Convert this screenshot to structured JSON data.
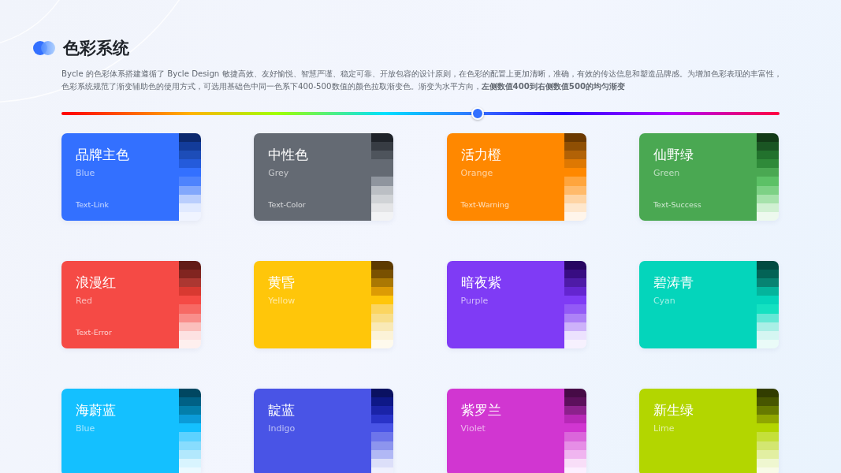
{
  "title": "色彩系统",
  "description": "Bycle 的色彩体系搭建遵循了 Bycle Design 敏捷高效、友好愉悦、智慧严谨、稳定可靠、开放包容的设计原则，在色彩的配置上更加清晰，准确，有效的传达信息和塑造品牌感。为增加色彩表现的丰富性，色彩系统规范了渐变辅助色的使用方式，可选用基础色中同一色系下400-500数值的颜色拉取渐变色。渐变为水平方向，**左侧数值400到右侧数值500的均匀渐变**",
  "gradient_slider": {
    "level": 0.58
  },
  "cards": [
    {
      "name": "品牌主色",
      "english": "Blue",
      "role": "Text-Link",
      "color": "#3370ff",
      "swatches": [
        {
          "color": "#0c296e"
        },
        {
          "color": "#133c9a"
        },
        {
          "color": "#1d4db8"
        },
        {
          "color": "#245bdb"
        },
        {
          "color": "#3370ff"
        },
        {
          "color": "#4e83fd"
        },
        {
          "color": "#82a7fc"
        },
        {
          "color": "#bacefd"
        },
        {
          "color": "#e1eaff"
        },
        {
          "color": "#f0f4ff"
        }
      ]
    },
    {
      "name": "中性色",
      "english": "Grey",
      "role": "Text-Color",
      "color": "#646a73",
      "swatches": [
        {
          "color": "#1f2329"
        },
        {
          "color": "#373c43"
        },
        {
          "color": "#4e545c"
        },
        {
          "color": "#646a73"
        },
        {
          "color": "#646a73"
        },
        {
          "color": "#8f959e"
        },
        {
          "color": "#bbbfc4"
        },
        {
          "color": "#d0d3d6"
        },
        {
          "color": "#e4e5e7"
        },
        {
          "color": "#f2f3f5"
        }
      ]
    },
    {
      "name": "活力橙",
      "english": "Orange",
      "role": "Text-Warning",
      "color": "#ff8800",
      "swatches": [
        {
          "color": "#6b3900"
        },
        {
          "color": "#8f4f04"
        },
        {
          "color": "#b26206"
        },
        {
          "color": "#de7802"
        },
        {
          "color": "#ff8800"
        },
        {
          "color": "#ffa53d"
        },
        {
          "color": "#ffba6b"
        },
        {
          "color": "#fed4a4"
        },
        {
          "color": "#fee7cd"
        },
        {
          "color": "#fff5eb"
        }
      ]
    },
    {
      "name": "仙野绿",
      "english": "Green",
      "role": "Text-Success",
      "color": "#4aa852",
      "swatches": [
        {
          "color": "#123a17"
        },
        {
          "color": "#1a5523"
        },
        {
          "color": "#22722d"
        },
        {
          "color": "#2f8a39"
        },
        {
          "color": "#4aa852"
        },
        {
          "color": "#5cc166"
        },
        {
          "color": "#7dd185"
        },
        {
          "color": "#a6e2ab"
        },
        {
          "color": "#d0f0d2"
        },
        {
          "color": "#edf9ee"
        }
      ]
    },
    {
      "name": "浪漫红",
      "english": "Red",
      "role": "Text-Error",
      "color": "#f54a45",
      "swatches": [
        {
          "color": "#621c18"
        },
        {
          "color": "#812520"
        },
        {
          "color": "#ac3731"
        },
        {
          "color": "#d83931"
        },
        {
          "color": "#f54a45"
        },
        {
          "color": "#f76964"
        },
        {
          "color": "#f98e8b"
        },
        {
          "color": "#fbbfbc"
        },
        {
          "color": "#fde2e2"
        },
        {
          "color": "#feefee"
        }
      ]
    },
    {
      "name": "黄昏",
      "english": "Yellow",
      "color": "#ffc60a",
      "swatches": [
        {
          "color": "#5c3a00"
        },
        {
          "color": "#795101"
        },
        {
          "color": "#aa7803"
        },
        {
          "color": "#dc9b04"
        },
        {
          "color": "#ffc60a"
        },
        {
          "color": "#fbd560"
        },
        {
          "color": "#f8de8a"
        },
        {
          "color": "#f9e9b6"
        },
        {
          "color": "#fcf3d8"
        },
        {
          "color": "#fefaed"
        }
      ]
    },
    {
      "name": "暗夜紫",
      "english": "Purple",
      "color": "#7f3bf5",
      "swatches": [
        {
          "color": "#270561"
        },
        {
          "color": "#380d82"
        },
        {
          "color": "#4e1ba7"
        },
        {
          "color": "#6425d0"
        },
        {
          "color": "#7f3bf5"
        },
        {
          "color": "#935af6"
        },
        {
          "color": "#ad82f7"
        },
        {
          "color": "#cdb2fa"
        },
        {
          "color": "#ece2fe"
        },
        {
          "color": "#f6f1fe"
        }
      ]
    },
    {
      "name": "碧涛青",
      "english": "Cyan",
      "color": "#04d5bb",
      "swatches": [
        {
          "color": "#024b41"
        },
        {
          "color": "#036356"
        },
        {
          "color": "#078372"
        },
        {
          "color": "#04b49c"
        },
        {
          "color": "#04d5bb"
        },
        {
          "color": "#14e1c1"
        },
        {
          "color": "#64e8d6"
        },
        {
          "color": "#a9efe6"
        },
        {
          "color": "#d5f6f2"
        },
        {
          "color": "#eafbf8"
        }
      ]
    },
    {
      "name": "海蔚蓝",
      "english": "Blue",
      "color": "#14c0ff",
      "swatches": [
        {
          "color": "#004761"
        },
        {
          "color": "#006185"
        },
        {
          "color": "#037eaa"
        },
        {
          "color": "#0b9bd8"
        },
        {
          "color": "#14c0ff"
        },
        {
          "color": "#5dd2ff"
        },
        {
          "color": "#88dcfd"
        },
        {
          "color": "#b2e8fd"
        },
        {
          "color": "#d8f4fe"
        },
        {
          "color": "#ebf9ff"
        }
      ]
    },
    {
      "name": "靛蓝",
      "english": "Indigo",
      "color": "#4954e6",
      "swatches": [
        {
          "color": "#0a1161"
        },
        {
          "color": "#0e1887"
        },
        {
          "color": "#1a23a8"
        },
        {
          "color": "#2933c8"
        },
        {
          "color": "#4954e6"
        },
        {
          "color": "#6d75eb"
        },
        {
          "color": "#8d95ee"
        },
        {
          "color": "#b1b8f5"
        },
        {
          "color": "#dcdff9"
        },
        {
          "color": "#eff0fd"
        }
      ]
    },
    {
      "name": "紫罗兰",
      "english": "Violet",
      "color": "#d136d1",
      "swatches": [
        {
          "color": "#460b46"
        },
        {
          "color": "#5c105c"
        },
        {
          "color": "#8c218c"
        },
        {
          "color": "#b728b7"
        },
        {
          "color": "#d136d1"
        },
        {
          "color": "#db66db"
        },
        {
          "color": "#e68ee6"
        },
        {
          "color": "#f0b5f0"
        },
        {
          "color": "#f8def8"
        },
        {
          "color": "#fcefff"
        }
      ]
    },
    {
      "name": "新生绿",
      "english": "Lime",
      "color": "#b3d600",
      "swatches": [
        {
          "color": "#323d00"
        },
        {
          "color": "#475600"
        },
        {
          "color": "#667a00"
        },
        {
          "color": "#8fa600"
        },
        {
          "color": "#b3d600"
        },
        {
          "color": "#c5e03a"
        },
        {
          "color": "#d3e671"
        },
        {
          "color": "#e2efa2"
        },
        {
          "color": "#eff7d0"
        },
        {
          "color": "#f8fbe8"
        }
      ]
    }
  ]
}
